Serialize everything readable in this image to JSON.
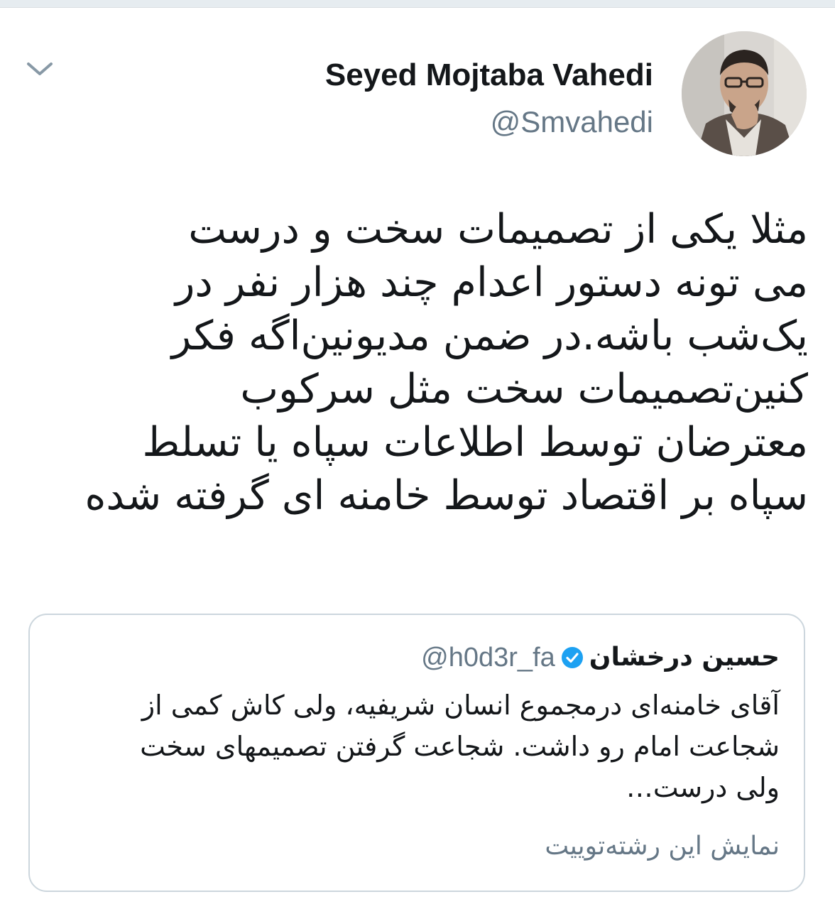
{
  "tweet": {
    "author": {
      "display_name": "Seyed Mojtaba Vahedi",
      "handle": "@Smvahedi",
      "avatar_icon": "profile-photo"
    },
    "menu_icon": "chevron-down-icon",
    "text_lines": [
      "مثلا یکی از تصمیمات سخت و درست",
      "می تونه دستور اعدام چند هزار نفر در",
      "یک‌شب باشه.در ضمن مدیونین‌اگه فکر",
      "کنین‌تصمیمات سخت  مثل سرکوب",
      "معترضان توسط اطلاعات سپاه یا تسلط",
      "سپاه بر اقتصاد توسط خامنه ای گرفته شده"
    ]
  },
  "quoted_tweet": {
    "display_name": "حسین درخشان",
    "handle": "@h0d3r_fa",
    "verified": true,
    "text_lines": [
      "آقای خامنه‌ای درمجموع انسان شریفیه، ولی کاش کمی از",
      "شجاعت امام رو داشت. شجاعت گرفتن تصمیمهای سخت",
      "ولی درست…"
    ],
    "show_thread_label": "نمایش این رشته‌توییت"
  },
  "colors": {
    "text": "#14171a",
    "secondary": "#657786",
    "border": "#ccd6dd",
    "verified_badge": "#1da1f2"
  }
}
